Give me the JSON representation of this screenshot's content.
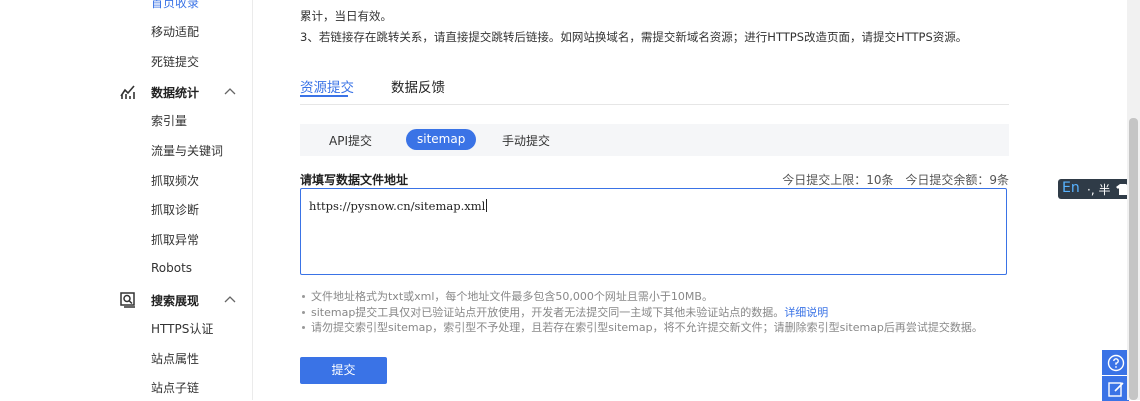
{
  "sidebar": {
    "cut_item": "首页收录",
    "items_top": [
      "移动适配",
      "死链提交"
    ],
    "group_stats": {
      "label": "数据统计",
      "icon": "chart-icon"
    },
    "items_stats": [
      "索引量",
      "流量与关键词",
      "抓取频次",
      "抓取诊断",
      "抓取异常",
      "Robots"
    ],
    "group_search": {
      "label": "搜索展现",
      "icon": "search-display-icon"
    },
    "items_search": [
      "HTTPS认证",
      "站点属性",
      "站点子链"
    ]
  },
  "notes": {
    "line1": "累计，当日有效。",
    "line2": "3、若链接存在跳转关系，请直接提交跳转后链接。如网站换域名，需提交新域名资源；进行HTTPS改造页面，请提交HTTPS资源。"
  },
  "tabs": [
    "资源提交",
    "数据反馈"
  ],
  "subtabs": [
    "API提交",
    "sitemap",
    "手动提交"
  ],
  "form": {
    "label": "请填写数据文件地址",
    "quota_limit": "今日提交上限：10条",
    "quota_remaining": "今日提交余额：9条",
    "value": "https://pysnow.cn/sitemap.xml"
  },
  "hints": {
    "h1": "文件地址格式为txt或xml，每个地址文件最多包含50,000个网址且需小于10MB。",
    "h2": "sitemap提交工具仅对已验证站点开放使用，开发者无法提交同一主域下其他未验证站点的数据。",
    "h2_link": "详细说明",
    "h3": "请勿提交索引型sitemap，索引型不予处理，且若存在索引型sitemap，将不允许提交新文件；请删除索引型sitemap后再尝试提交数据。"
  },
  "submit_label": "提交",
  "ime": {
    "mode": "En",
    "rest": "·, 半"
  },
  "colors": {
    "accent": "#3a73e6",
    "ime_bg": "#2f3b47"
  }
}
